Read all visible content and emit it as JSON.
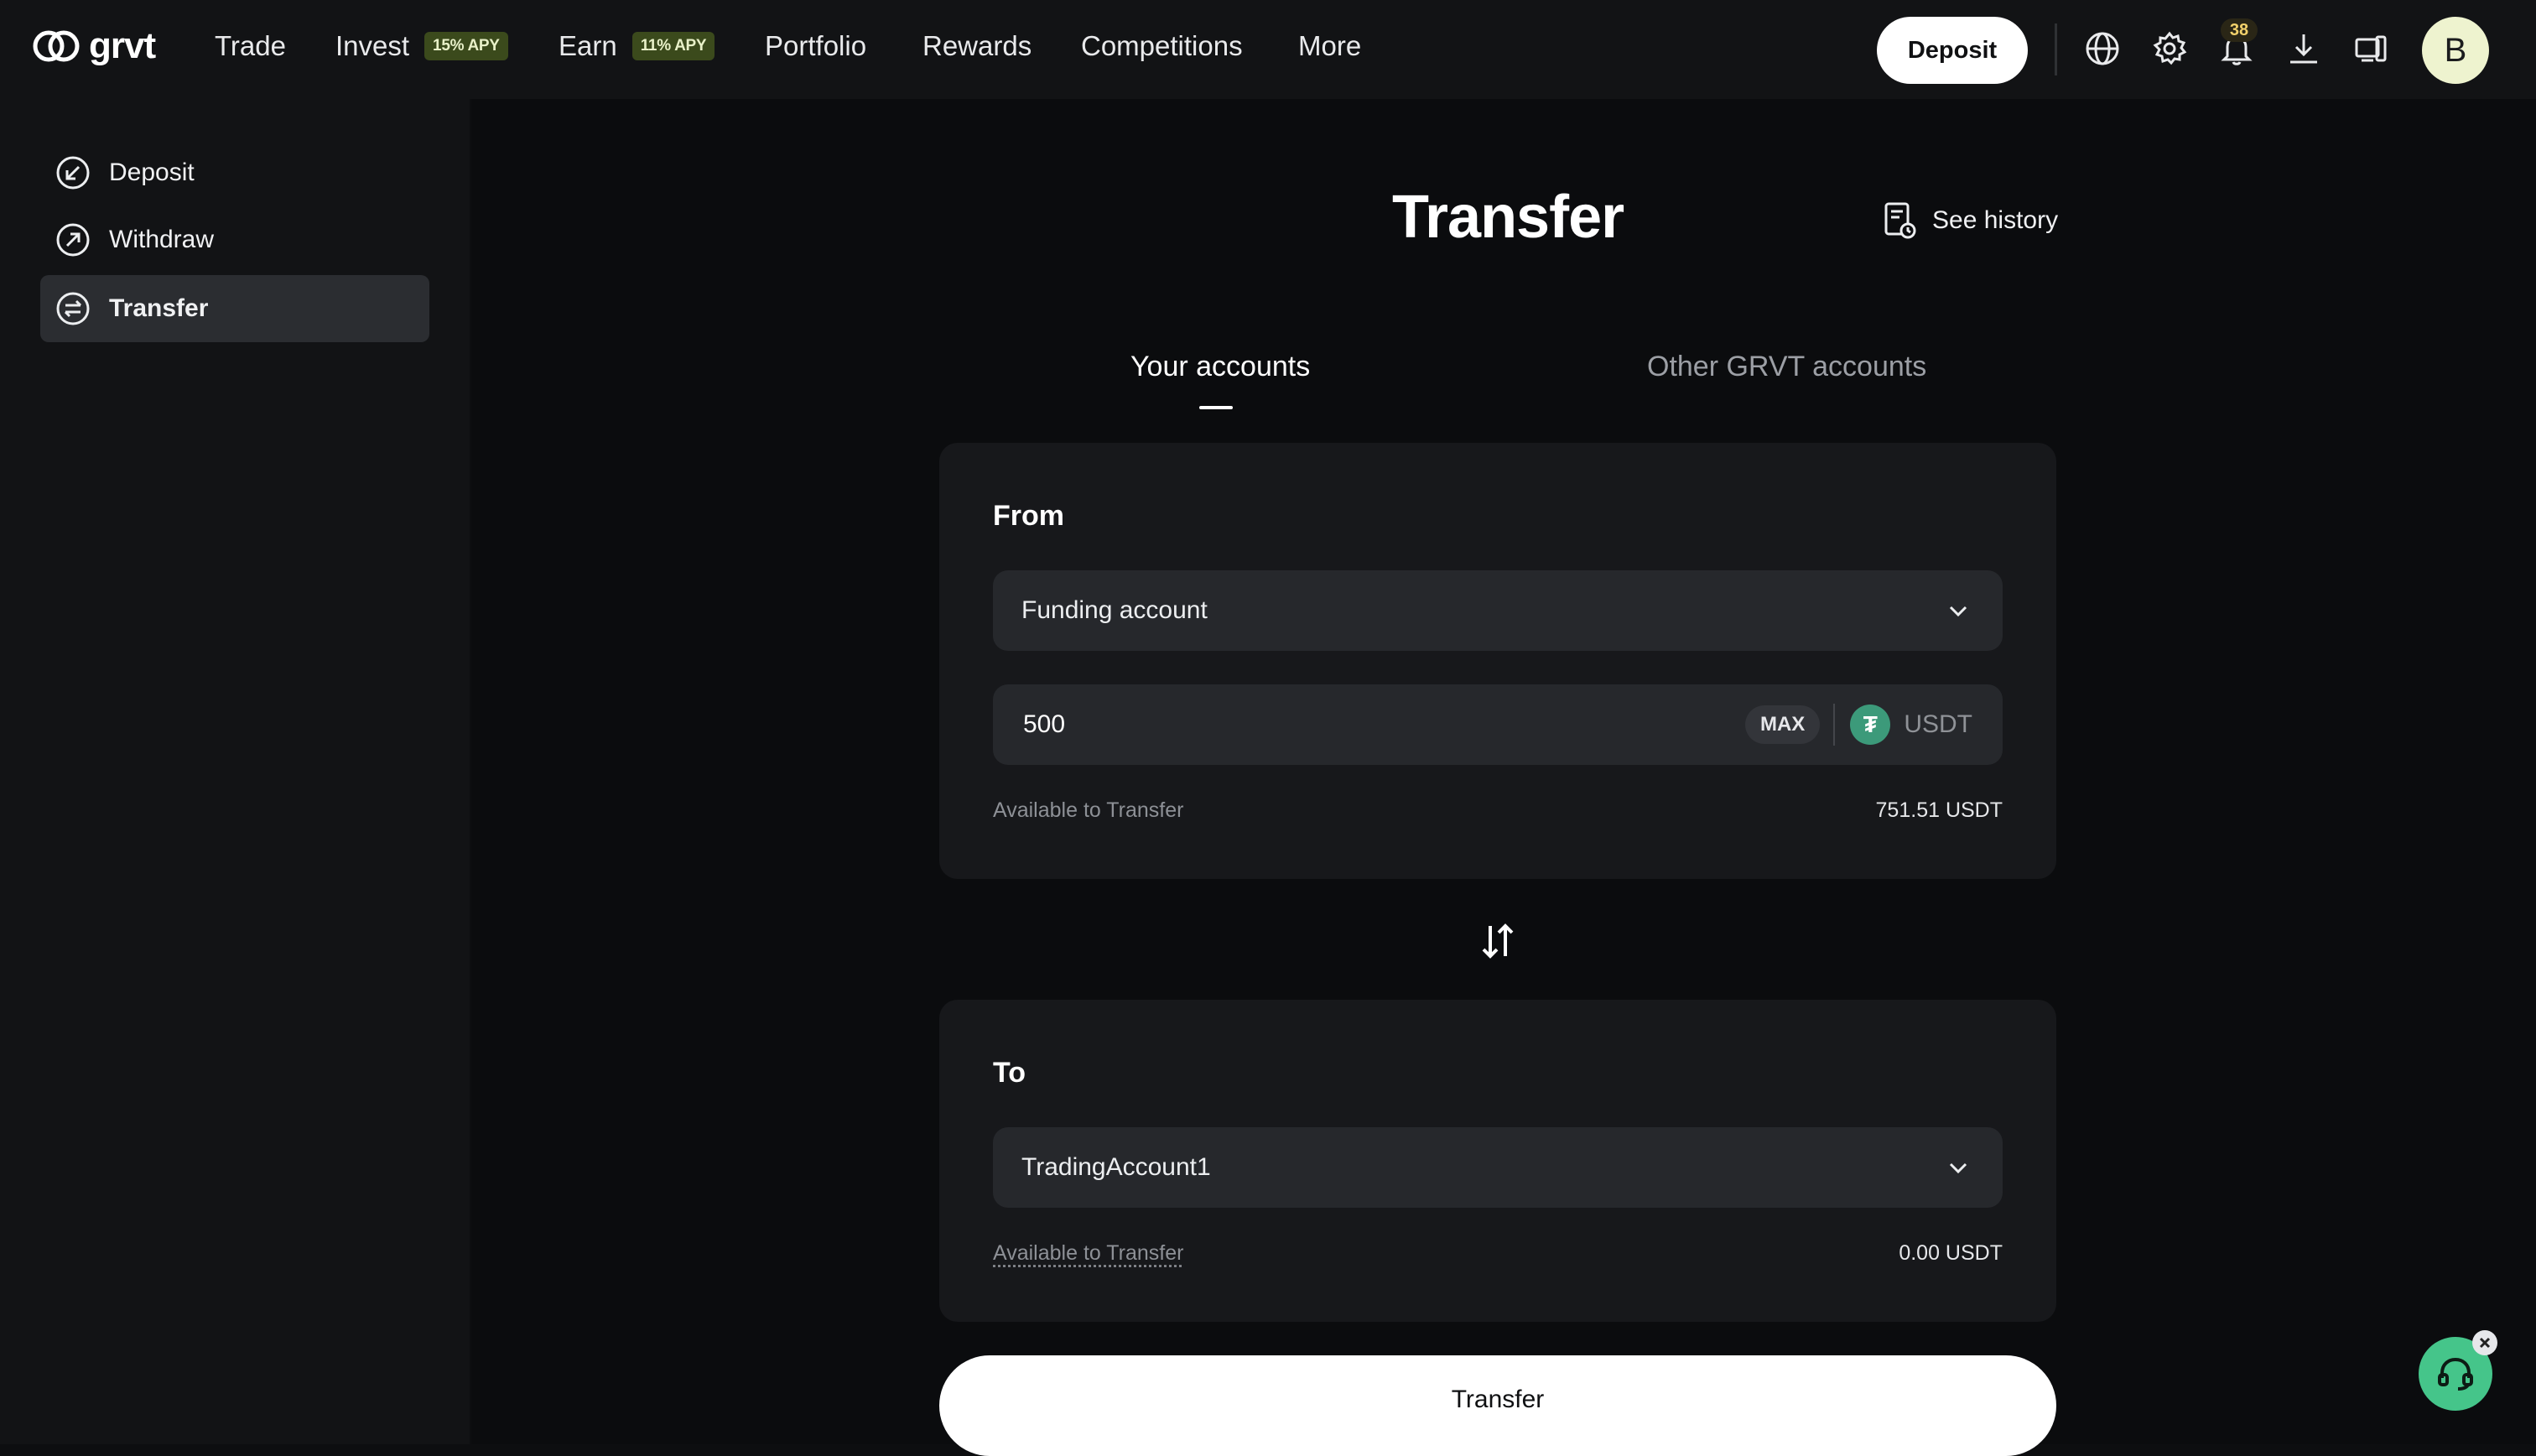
{
  "brand": {
    "name": "grvt"
  },
  "nav": {
    "items": [
      {
        "label": "Trade"
      },
      {
        "label": "Invest",
        "badge": "15% APY"
      },
      {
        "label": "Earn",
        "badge": "11% APY"
      },
      {
        "label": "Portfolio"
      },
      {
        "label": "Rewards"
      },
      {
        "label": "Competitions"
      },
      {
        "label": "More"
      }
    ],
    "deposit_label": "Deposit",
    "notification_count": "38",
    "avatar_initial": "B",
    "icons": [
      "globe-icon",
      "gear-icon",
      "bell-icon",
      "download-icon",
      "devices-icon"
    ]
  },
  "sidebar": {
    "items": [
      {
        "label": "Deposit",
        "icon": "arrow-in-icon"
      },
      {
        "label": "Withdraw",
        "icon": "arrow-out-icon"
      },
      {
        "label": "Transfer",
        "icon": "transfer-icon",
        "active": true
      }
    ]
  },
  "main": {
    "title": "Transfer",
    "history_label": "See history",
    "tabs": [
      {
        "label": "Your accounts",
        "active": true
      },
      {
        "label": "Other GRVT accounts",
        "active": false
      }
    ],
    "from": {
      "label": "From",
      "account": "Funding account",
      "amount": "500",
      "max_label": "MAX",
      "currency": "USDT",
      "available_label": "Available to Transfer",
      "available_value": "751.51 USDT"
    },
    "to": {
      "label": "To",
      "account": "TradingAccount1",
      "available_label": "Available to Transfer",
      "available_value": "0.00 USDT"
    },
    "submit_label": "Transfer"
  },
  "colors": {
    "background": "#0b0c0e",
    "panel": "#17181b",
    "input": "#26282c",
    "apy_badge_bg": "#3b4a1c",
    "usdt_green": "#3c9a7a",
    "support_green": "#45c58a"
  }
}
